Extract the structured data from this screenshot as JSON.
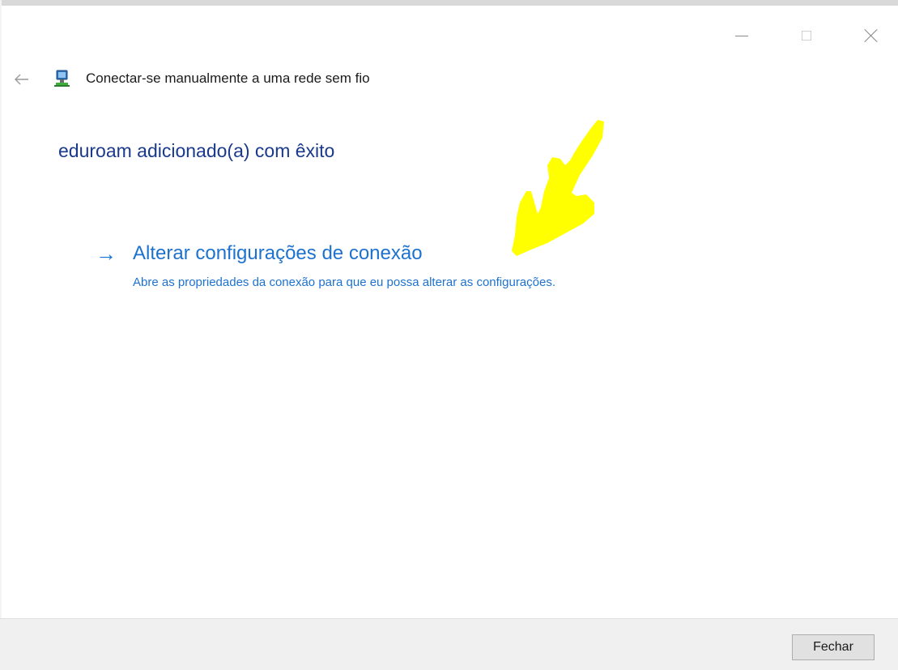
{
  "window": {
    "title": "Conectar-se manualmente a uma rede sem fio",
    "controls": {
      "minimize_icon": "minimize-icon",
      "maximize_icon": "maximize-icon",
      "close_icon": "close-icon"
    },
    "back_icon": "back-arrow-icon",
    "network_icon": "network-icon"
  },
  "content": {
    "heading": "eduroam adicionado(a) com êxito",
    "command_link": {
      "arrow": "→",
      "title": "Alterar configurações de conexão",
      "description": "Abre as propriedades da conexão para que eu possa alterar as configurações."
    },
    "annotation_color": "#ffff00"
  },
  "footer": {
    "close_label": "Fechar"
  },
  "colors": {
    "link": "#1d72d0",
    "heading": "#193a8c",
    "footer_bg": "#f0f0f0"
  }
}
